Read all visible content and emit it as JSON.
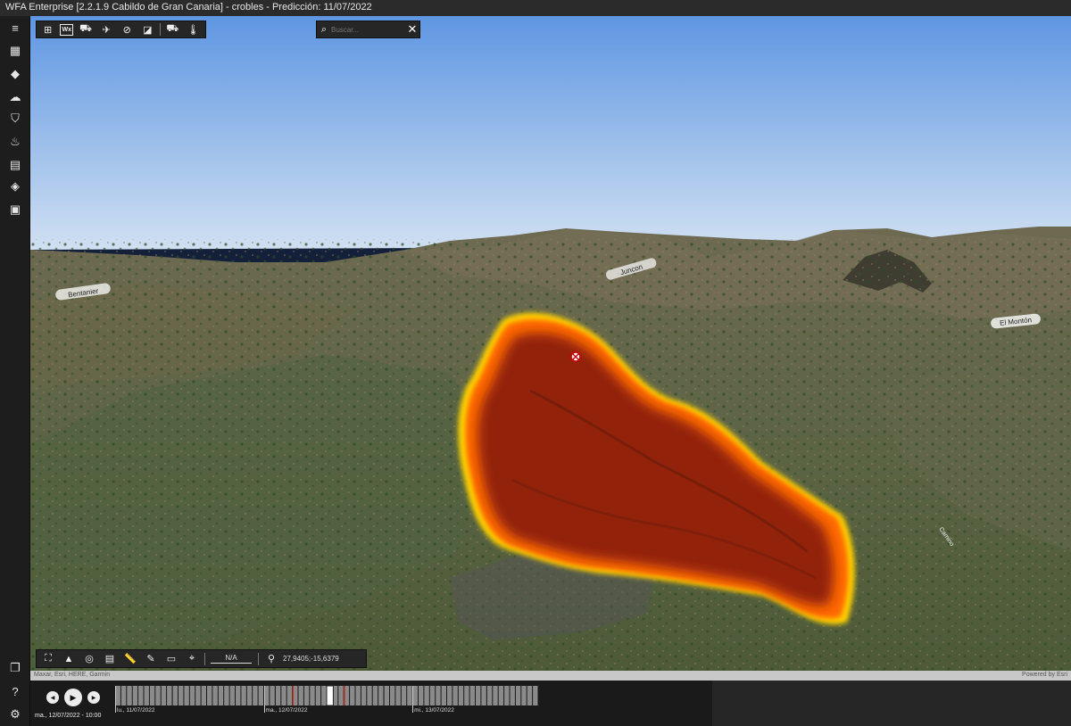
{
  "window": {
    "title": "WFA Enterprise [2.2.1.9 Cabildo de Gran Canaria] - crobles - Predicción: 11/07/2022"
  },
  "left_toolbar": {
    "top_items": [
      {
        "name": "menu-icon",
        "glyph": "≡"
      },
      {
        "name": "calendar-icon",
        "glyph": "▦"
      },
      {
        "name": "route-icon",
        "glyph": "◆"
      },
      {
        "name": "weather-icon",
        "glyph": "☁"
      },
      {
        "name": "shield-icon",
        "glyph": "⛉"
      },
      {
        "name": "fire-icon",
        "glyph": "♨"
      },
      {
        "name": "folder-settings-icon",
        "glyph": "▤"
      },
      {
        "name": "layers-icon",
        "glyph": "◈"
      },
      {
        "name": "grid-icon",
        "glyph": "▣"
      }
    ],
    "bottom_items": [
      {
        "name": "windows-icon",
        "glyph": "❐"
      },
      {
        "name": "help-icon",
        "glyph": "?"
      },
      {
        "name": "settings-icon",
        "glyph": "⚙"
      }
    ]
  },
  "map_toolbar": {
    "items": [
      {
        "name": "map-pin-icon",
        "glyph": "⊞"
      },
      {
        "name": "wx-icon",
        "glyph": "Wx"
      },
      {
        "name": "vehicle-icon",
        "glyph": "⛟"
      },
      {
        "name": "satellite-icon",
        "glyph": "✈"
      },
      {
        "name": "no-entry-icon",
        "glyph": "⊘"
      },
      {
        "name": "shapes-icon",
        "glyph": "◪"
      },
      {
        "name": "fire-truck-icon",
        "glyph": "⛟"
      },
      {
        "name": "thermometer-icon",
        "glyph": "🌡"
      }
    ]
  },
  "search": {
    "placeholder": "Buscar..."
  },
  "map": {
    "labels": [
      {
        "text": "Bentanier"
      },
      {
        "text": "Juncon"
      },
      {
        "text": "El Montón"
      },
      {
        "text": "Camino"
      }
    ],
    "colors": {
      "sky_top": "#5e96e2",
      "sky_bottom": "#dde8f4",
      "fire_outer": "#ffd400",
      "fire_mid": "#ff6a00",
      "fire_core": "#8a1a0a"
    }
  },
  "map_bottom_toolbar": {
    "items": [
      {
        "name": "fullscreen-icon",
        "glyph": "⛶"
      },
      {
        "name": "compass-icon",
        "glyph": "▲"
      },
      {
        "name": "locate-icon",
        "glyph": "◎"
      },
      {
        "name": "table-icon",
        "glyph": "▤"
      },
      {
        "name": "ruler-icon",
        "glyph": "📏"
      },
      {
        "name": "pencil-icon",
        "glyph": "✎"
      },
      {
        "name": "monitor-icon",
        "glyph": "▭"
      },
      {
        "name": "pin-icon",
        "glyph": "⌖"
      }
    ],
    "scale": "N/A",
    "coordinates": "27,9405;-15,6379"
  },
  "attribution": {
    "left": "Maxar, Esri, HERE, Garmin",
    "right": "Powered by Esri"
  },
  "timeline": {
    "current_time": "ma., 12/07/2022 - 10:00",
    "days": [
      {
        "label": "lu., 11/07/2022"
      },
      {
        "label": "ma., 12/07/2022"
      },
      {
        "label": "mi., 13/07/2022"
      }
    ],
    "tick_count": 74,
    "handle_index": 37,
    "markers": [
      31,
      40
    ]
  }
}
